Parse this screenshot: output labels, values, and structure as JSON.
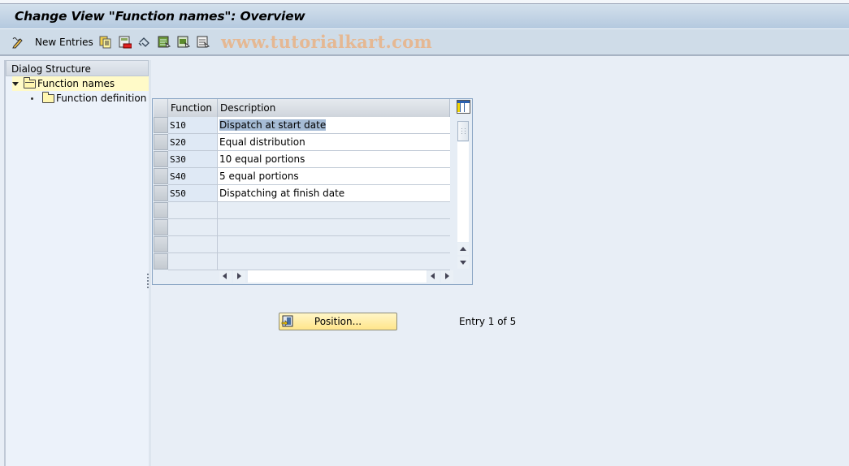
{
  "window": {
    "title": "Change View \"Function names\": Overview"
  },
  "toolbar": {
    "items": [
      {
        "icon": "display-change-icon",
        "label": ""
      },
      {
        "icon": "new-entries-icon",
        "label": "New Entries"
      },
      {
        "icon": "copy-icon",
        "label": ""
      },
      {
        "icon": "delete-icon",
        "label": ""
      },
      {
        "icon": "undo-change-icon",
        "label": ""
      },
      {
        "icon": "select-all-icon",
        "label": ""
      },
      {
        "icon": "select-block-icon",
        "label": ""
      },
      {
        "icon": "deselect-all-icon",
        "label": ""
      }
    ],
    "watermark": "www.tutorialkart.com"
  },
  "dialog_structure": {
    "header": "Dialog Structure",
    "nodes": [
      {
        "label": "Function names",
        "expanded": true,
        "selected": true,
        "level": 0
      },
      {
        "label": "Function definition",
        "expanded": false,
        "selected": false,
        "level": 1
      }
    ]
  },
  "table": {
    "columns": [
      "Function",
      "Description"
    ],
    "rows": [
      {
        "function": "S10",
        "description": "Dispatch at start date",
        "highlighted": true
      },
      {
        "function": "S20",
        "description": "Equal distribution",
        "highlighted": false
      },
      {
        "function": "S30",
        "description": "10 equal portions",
        "highlighted": false
      },
      {
        "function": "S40",
        "description": "5 equal portions",
        "highlighted": false
      },
      {
        "function": "S50",
        "description": "Dispatching at finish date",
        "highlighted": false
      }
    ],
    "empty_rows": 4
  },
  "footer": {
    "position_button": "Position...",
    "entry_status": "Entry 1 of 5"
  },
  "colors": {
    "title_bar": "#b4c9df",
    "toolbar": "#cfdce8",
    "background": "#e8eef6",
    "selection_highlight": "#a6bcd6",
    "selected_node": "#fffac8",
    "button_yellow": "#ffe58a",
    "watermark": "#e8b58a"
  }
}
